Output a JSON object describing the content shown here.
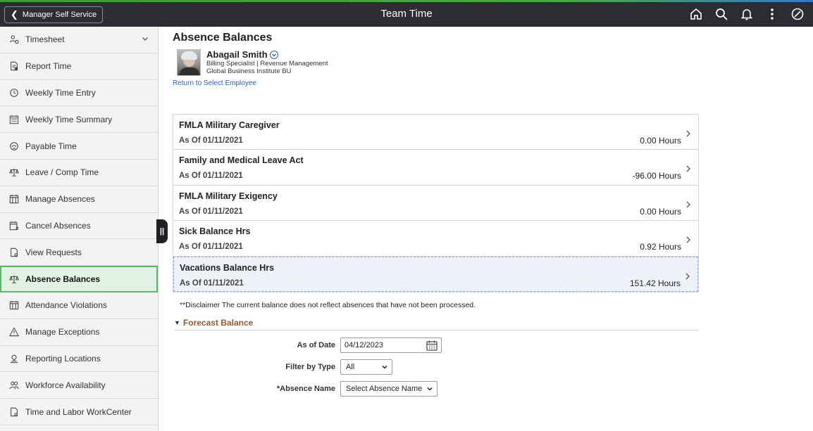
{
  "header": {
    "back_label": "Manager Self Service",
    "title": "Team Time",
    "icons": [
      "home-icon",
      "search-icon",
      "bell-icon",
      "more-icon",
      "navbar-icon"
    ]
  },
  "sidebar": {
    "items": [
      {
        "label": "Timesheet",
        "icon": "person-clock-icon",
        "has_caret": true
      },
      {
        "label": "Report Time",
        "icon": "report-icon"
      },
      {
        "label": "Weekly Time Entry",
        "icon": "clock-icon"
      },
      {
        "label": "Weekly Time Summary",
        "icon": "calendar-grid-icon"
      },
      {
        "label": "Payable Time",
        "icon": "payable-icon"
      },
      {
        "label": "Leave / Comp Time",
        "icon": "scale-icon"
      },
      {
        "label": "Manage Absences",
        "icon": "calendar-icon"
      },
      {
        "label": "Cancel Absences",
        "icon": "calendar-cancel-icon"
      },
      {
        "label": "View Requests",
        "icon": "document-icon"
      },
      {
        "label": "Absence Balances",
        "icon": "scale-icon",
        "active": true
      },
      {
        "label": "Attendance Violations",
        "icon": "calendar-icon"
      },
      {
        "label": "Manage Exceptions",
        "icon": "warning-icon"
      },
      {
        "label": "Reporting Locations",
        "icon": "location-icon"
      },
      {
        "label": "Workforce Availability",
        "icon": "people-icon"
      },
      {
        "label": "Time and Labor WorkCenter",
        "icon": "document-icon"
      }
    ]
  },
  "main": {
    "title": "Absence Balances",
    "employee": {
      "name": "Abagail Smith",
      "line1": "Billing Specialist | Revenue Management",
      "line2": "Global Business Institute BU",
      "return_link": "Return to Select Employee"
    },
    "balances": [
      {
        "name": "FMLA Military Caregiver",
        "as_of": "As Of 01/11/2021",
        "value": "0.00 Hours"
      },
      {
        "name": "Family and Medical Leave Act",
        "as_of": "As Of 01/11/2021",
        "value": "-96.00 Hours"
      },
      {
        "name": "FMLA Military Exigency",
        "as_of": "As Of 01/11/2021",
        "value": "0.00 Hours"
      },
      {
        "name": "Sick Balance Hrs",
        "as_of": "As Of 01/11/2021",
        "value": "0.92 Hours"
      },
      {
        "name": "Vacations Balance Hrs",
        "as_of": "As Of 01/11/2021",
        "value": "151.42 Hours",
        "selected": true
      }
    ],
    "disclaimer": "**Disclaimer  The current balance does not reflect absences that have not been processed.",
    "forecast": {
      "title": "Forecast Balance",
      "as_of_label": "As of Date",
      "as_of_value": "04/12/2023",
      "filter_label": "Filter by Type",
      "filter_value": "All",
      "absence_label": "*Absence Name",
      "absence_value": "Select Absence Name"
    }
  },
  "colors": {
    "header_bg": "#2b2d32",
    "active_bg": "#e1f2e3",
    "active_border": "#5db56b",
    "link": "#2a62b8",
    "forecast_title": "#a0582a"
  }
}
